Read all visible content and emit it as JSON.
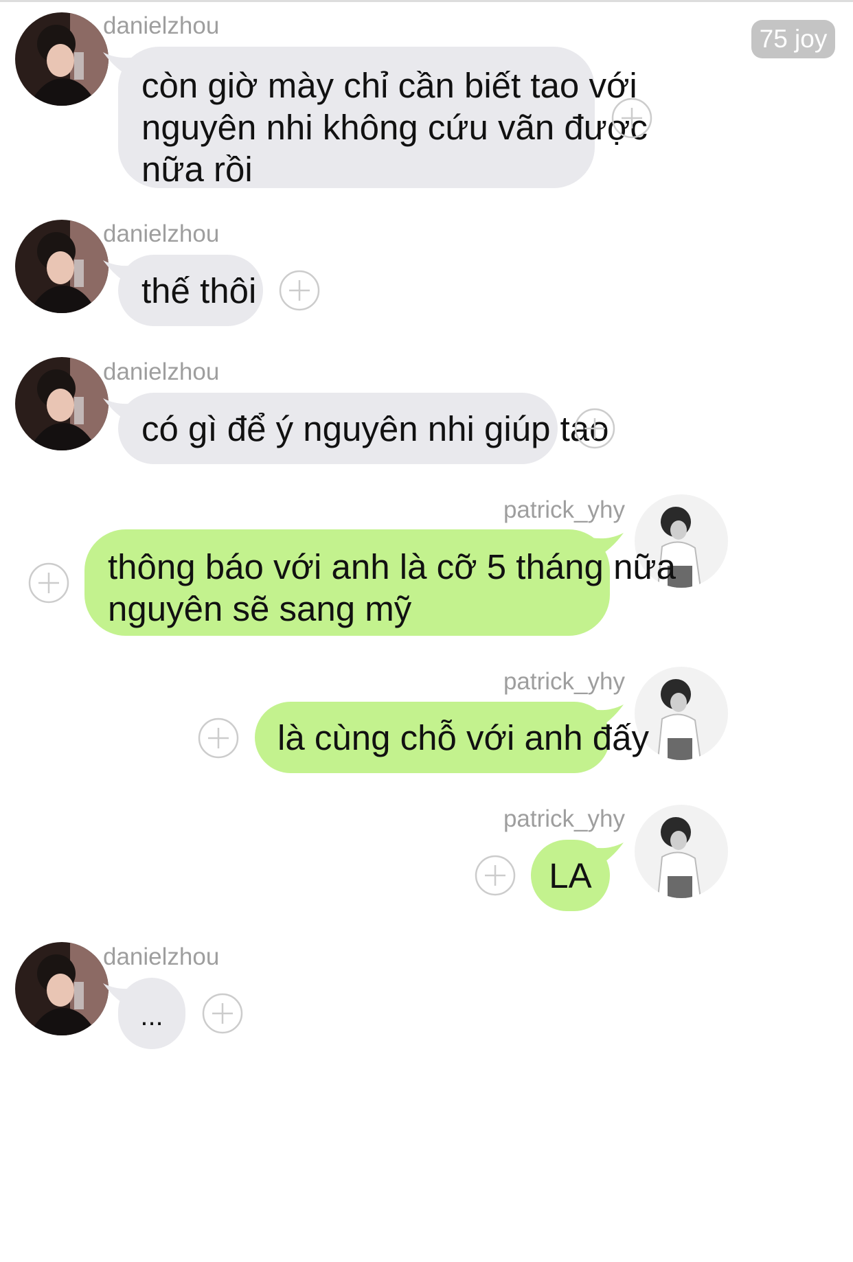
{
  "header": {
    "badge_label": "75 joy"
  },
  "colors": {
    "incoming_bubble": "#e9e9ed",
    "outgoing_bubble": "#c3f28e",
    "username_text": "#9e9e9e",
    "badge_bg": "#c4c4c4"
  },
  "messages": [
    {
      "sender": "danielzhou",
      "direction": "incoming",
      "lines": [
        "còn giờ mày chỉ cần biết tao với",
        "nguyên nhi không cứu vãn được",
        "nữa rồi"
      ]
    },
    {
      "sender": "danielzhou",
      "direction": "incoming",
      "lines": [
        "thế thôi"
      ]
    },
    {
      "sender": "danielzhou",
      "direction": "incoming",
      "lines": [
        "có gì để ý nguyên nhi giúp tao"
      ]
    },
    {
      "sender": "patrick_yhy",
      "direction": "outgoing",
      "lines": [
        "thông báo với anh là cỡ 5 tháng nữa",
        "nguyên sẽ sang mỹ"
      ]
    },
    {
      "sender": "patrick_yhy",
      "direction": "outgoing",
      "lines": [
        "là cùng chỗ với anh đấy"
      ]
    },
    {
      "sender": "patrick_yhy",
      "direction": "outgoing",
      "lines": [
        "LA"
      ]
    },
    {
      "sender": "danielzhou",
      "direction": "incoming",
      "lines": [
        "..."
      ]
    }
  ],
  "icons": {
    "add_reaction": "plus-circle-icon",
    "avatar_incoming": "profile-photo-danielzhou",
    "avatar_outgoing": "profile-photo-patrick-yhy"
  }
}
